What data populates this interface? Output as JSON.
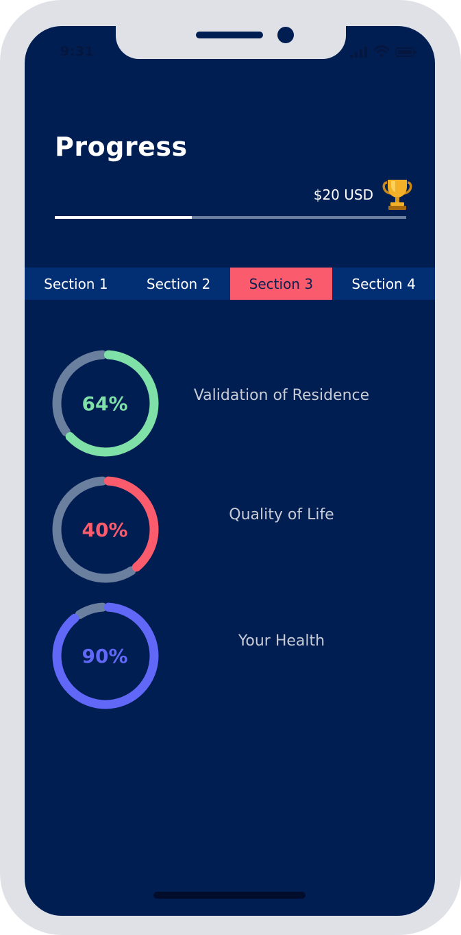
{
  "status_bar": {
    "time": "9:31"
  },
  "header": {
    "title": "Progress"
  },
  "reward": {
    "amount": "$20 USD",
    "icon": "trophy-icon"
  },
  "overall_progress": {
    "fraction": 0.39,
    "fill_color": "#ffffff",
    "track_color": "#6b7f9e"
  },
  "tabs": [
    {
      "label": "Section 1",
      "active": false
    },
    {
      "label": "Section 2",
      "active": false
    },
    {
      "label": "Section 3",
      "active": true
    },
    {
      "label": "Section 4",
      "active": false
    }
  ],
  "items": [
    {
      "percent_label": "64%",
      "percent": 64,
      "color": "#7fe0a8",
      "label": "Validation of Residence"
    },
    {
      "percent_label": "40%",
      "percent": 40,
      "color": "#fa5c6e",
      "label": "Quality of Life"
    },
    {
      "percent_label": "90%",
      "percent": 90,
      "color": "#6168f8",
      "label": "Your Health"
    }
  ],
  "colors": {
    "background": "#011e52",
    "tab_bar": "#022f74",
    "tab_active": "#fa5c6e",
    "ring_track": "#6b7f9e"
  }
}
